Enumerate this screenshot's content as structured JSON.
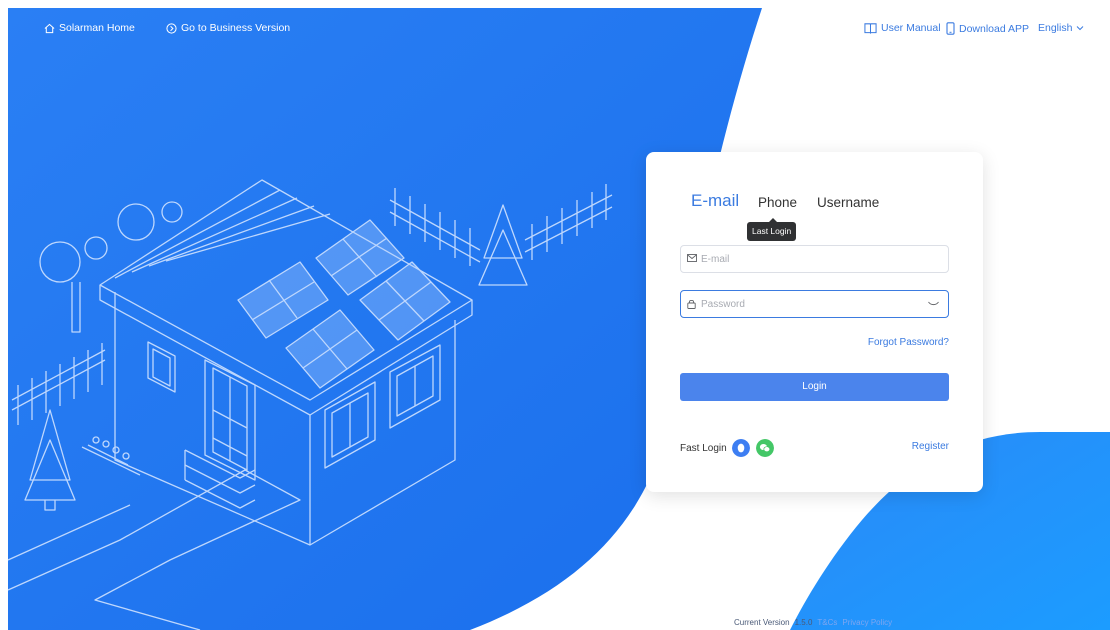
{
  "header": {
    "home_label": "Solarman Home",
    "business_label": "Go to Business Version",
    "manual_label": "User Manual",
    "download_label": "Download APP",
    "language_label": "English"
  },
  "login": {
    "tabs": [
      {
        "label": "E-mail",
        "active": true
      },
      {
        "label": "Phone",
        "active": false
      },
      {
        "label": "Username",
        "active": false
      }
    ],
    "tooltip": "Last Login",
    "email_placeholder": "E-mail",
    "password_placeholder": "Password",
    "forgot_label": "Forgot Password?",
    "login_button": "Login",
    "fast_login_label": "Fast Login",
    "register_label": "Register"
  },
  "footer": {
    "version_label": "Current Version",
    "version": "1.5.0",
    "tcs": "T&Cs",
    "privacy": "Privacy Policy"
  },
  "colors": {
    "brand_blue": "#2a80f2",
    "accent": "#3b7be0",
    "button": "#4b84ec",
    "qq_icon": "#3d7ef2",
    "wechat_icon": "#44c767"
  },
  "icons": [
    "home-icon",
    "arrow-circle-icon",
    "book-icon",
    "phone-icon",
    "chevron-down-icon",
    "mail-icon",
    "lock-icon",
    "eye-closed-icon",
    "qq-icon",
    "wechat-icon"
  ]
}
